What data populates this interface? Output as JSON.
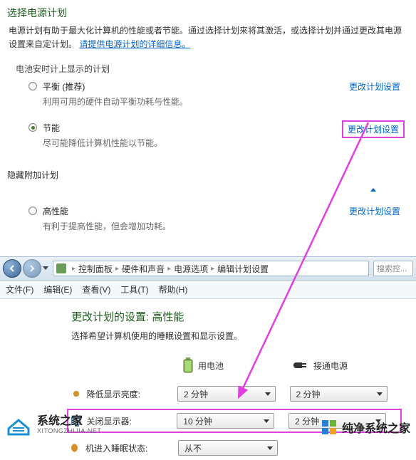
{
  "header": {
    "title": "选择电源计划",
    "description_prefix": "电源计划有助于最大化计算机的性能或者节能。通过选择计划来将其激活，或选择计划并通过更改其电源设置来自定计划。",
    "learn_more_link": "请提供电源计划的详细信息。"
  },
  "section1_label": "电池安时计上显示的计划",
  "plans": [
    {
      "name": "平衡 (推荐)",
      "desc": "利用可用的硬件自动平衡功耗与性能。",
      "checked": false,
      "change_link": "更改计划设置"
    },
    {
      "name": "节能",
      "desc": "尽可能降低计算机性能以节能。",
      "checked": true,
      "change_link": "更改计划设置"
    }
  ],
  "hidden_section_label": "隐藏附加计划",
  "hidden_plan": {
    "name": "高性能",
    "desc": "有利于提高性能，但会增加功耗。",
    "checked": false,
    "change_link": "更改计划设置"
  },
  "breadcrumb": {
    "items": [
      "控制面板",
      "硬件和声音",
      "电源选项",
      "编辑计划设置"
    ]
  },
  "search_placeholder": "搜索控...",
  "menu": {
    "file": "文件(F)",
    "edit": "编辑(E)",
    "view": "查看(V)",
    "tools": "工具(T)",
    "help": "帮助(H)"
  },
  "edit_plan": {
    "title": "更改计划的设置: 高性能",
    "desc": "选择希望计算机使用的睡眠设置和显示设置。",
    "col_battery": "用电池",
    "col_ac": "接通电源",
    "rows": [
      {
        "label": "降低显示亮度:",
        "battery": "2 分钟",
        "ac": "2 分钟"
      },
      {
        "label": "关闭显示器:",
        "battery": "10 分钟",
        "ac": "2 分钟"
      },
      {
        "label": "机进入睡眠状态:",
        "battery": "从不",
        "ac": ""
      }
    ]
  },
  "watermarks": {
    "left_title": "系统之家",
    "left_sub": "XITONGZHIJIA.NET",
    "right": "纯净系统之家"
  }
}
